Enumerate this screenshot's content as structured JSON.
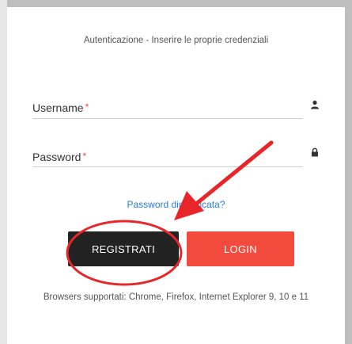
{
  "form": {
    "subtitle": "Autenticazione - Inserire le proprie credenziali",
    "username_label": "Username",
    "password_label": "Password",
    "required_mark": "*",
    "forgot_link": "Password dimenticata?",
    "register_button": "REGISTRATI",
    "login_button": "LOGIN",
    "supported_browsers": "Browsers supportati: Chrome, Firefox, Internet Explorer 9, 10 e 11"
  },
  "icons": {
    "username": "user-icon",
    "password": "lock-icon"
  },
  "colors": {
    "register_bg": "#222222",
    "login_bg": "#f24a3d",
    "link": "#2b7bd6",
    "annotation": "#e8262a"
  }
}
